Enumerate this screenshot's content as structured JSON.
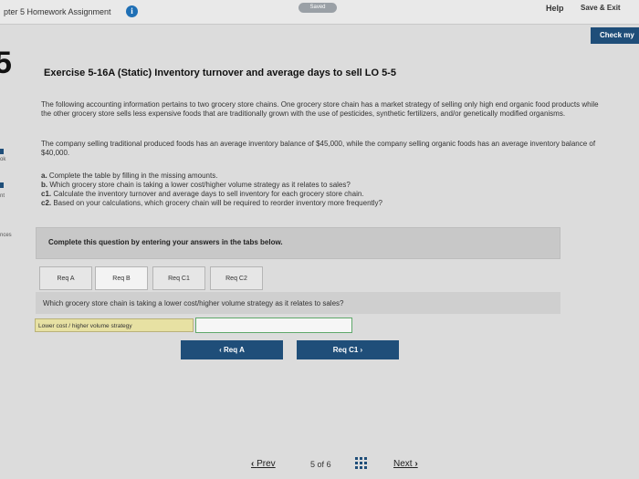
{
  "header": {
    "assignment_title": "pter 5 Homework Assignment",
    "info_icon": "info-icon",
    "saved_label": "Saved",
    "help_label": "Help",
    "save_exit_label": "Save & Exit"
  },
  "check_button_label": "Check my",
  "question_number": "5",
  "sidebar": {
    "items": [
      {
        "label": "ok"
      },
      {
        "label": "nt"
      },
      {
        "label": "nces"
      }
    ]
  },
  "exercise": {
    "title": "Exercise 5-16A (Static) Inventory turnover and average days to sell LO 5-5",
    "para1": "The following accounting information pertains to two grocery store chains. One grocery store chain has a market strategy of selling only high end organic food products while the other grocery store sells less expensive foods that are traditionally grown with the use of pesticides, synthetic fertilizers, and/or genetically modified organisms.",
    "para2": "The company selling traditional produced foods has an average inventory balance of $45,000, while the company selling organic foods has an average inventory balance of $40,000.",
    "tasks": [
      {
        "prefix": "a.",
        "text": " Complete the table by filling in the missing amounts."
      },
      {
        "prefix": "b.",
        "text": " Which grocery store chain is taking a lower cost/higher volume strategy as it relates to sales?"
      },
      {
        "prefix": "c1.",
        "text": " Calculate the inventory turnover and average days to sell inventory for each grocery store chain."
      },
      {
        "prefix": "c2.",
        "text": " Based on your calculations, which grocery chain will be required to reorder inventory more frequently?"
      }
    ]
  },
  "instructions": "Complete this question by entering your answers in the tabs below.",
  "tabs": [
    {
      "label": "Req A"
    },
    {
      "label": "Req B"
    },
    {
      "label": "Req C1"
    },
    {
      "label": "Req C2"
    }
  ],
  "question": "Which grocery store chain is taking a lower cost/higher volume strategy as it relates to sales?",
  "answer": {
    "label": "Lower cost / higher volume strategy",
    "value": ""
  },
  "nav": {
    "prev_label": "‹  Req A",
    "next_label": "Req C1  ›"
  },
  "footer": {
    "prev_label": "Prev",
    "page_current": "5",
    "page_of": "of",
    "page_total": "6",
    "next_label": "Next"
  }
}
